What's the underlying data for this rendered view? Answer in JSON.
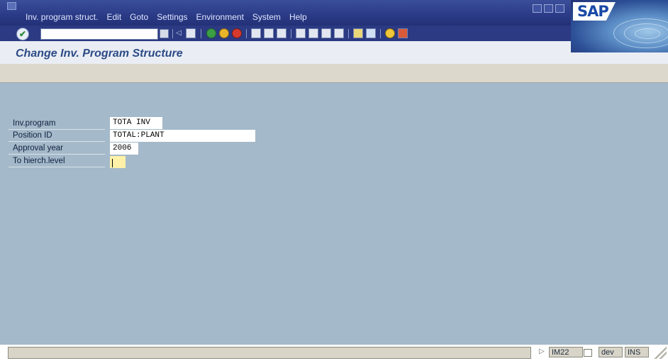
{
  "menu": {
    "items": [
      "Inv. program struct.",
      "Edit",
      "Goto",
      "Settings",
      "Environment",
      "System",
      "Help"
    ]
  },
  "logo": {
    "text": "SAP"
  },
  "toolbar": {
    "enter_icon": "check-icon",
    "command_value": "",
    "icons": [
      "save-icon",
      "back-icon",
      "exit-icon",
      "cancel-icon",
      "print-icon",
      "find-icon",
      "find-next-icon",
      "first-page-icon",
      "previous-page-icon",
      "next-page-icon",
      "last-page-icon",
      "create-session-icon",
      "shortcut-icon",
      "help-icon",
      "layout-icon"
    ]
  },
  "page": {
    "title": "Change Inv. Program Structure"
  },
  "form": {
    "fields": [
      {
        "label": "Inv.program",
        "value": "TOTA INV"
      },
      {
        "label": "Position ID",
        "value": "TOTAL:PLANT"
      },
      {
        "label": "Approval year",
        "value": "2006"
      },
      {
        "label": "To hierch.level",
        "value": ""
      }
    ]
  },
  "status": {
    "message": "",
    "transaction": "IM22",
    "system": "dev",
    "mode": "INS"
  },
  "colors": {
    "menubar": "#2a3a86",
    "work_area": "#a4b9c9",
    "title_text": "#2c4a86",
    "required_field": "#fff2a8"
  }
}
